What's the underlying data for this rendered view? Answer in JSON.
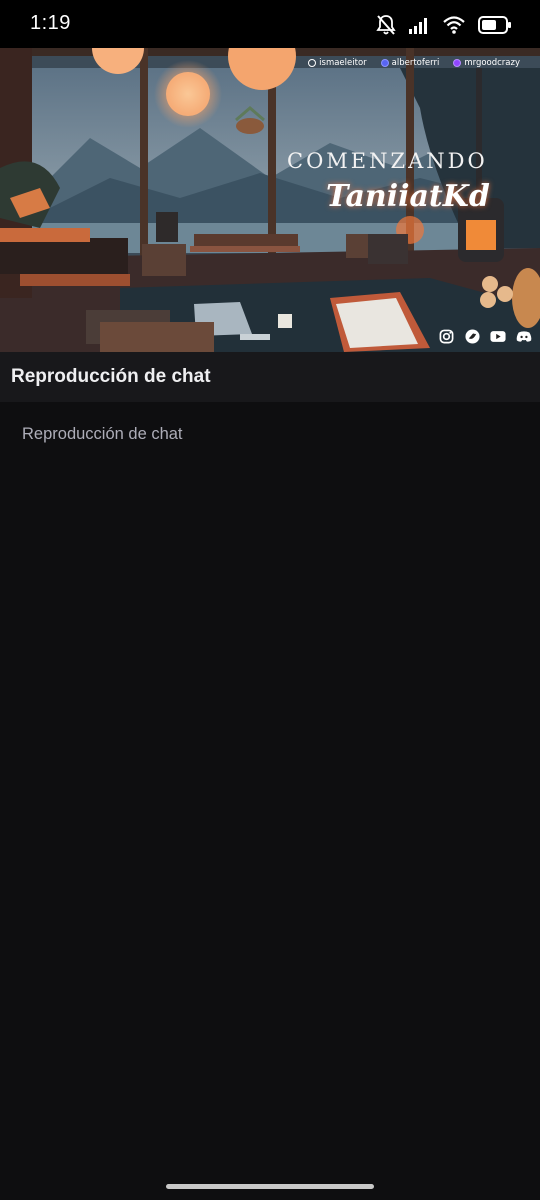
{
  "status_bar": {
    "time": "1:19"
  },
  "video": {
    "credits": [
      "ismaeleitor",
      "albertoferri",
      "mrgoodcrazy"
    ],
    "overlay_title": "COMENZANDO",
    "overlay_name": "TaniiatKd",
    "socials": [
      "instagram-icon",
      "twitter-icon",
      "youtube-icon",
      "discord-icon"
    ]
  },
  "header": {
    "title": "Reproducción de chat"
  },
  "chat": {
    "placeholder": "Reproducción de chat"
  },
  "colors": {
    "background": "#0e0e10",
    "header_bg": "#18181b",
    "accent": "#9146ff"
  }
}
